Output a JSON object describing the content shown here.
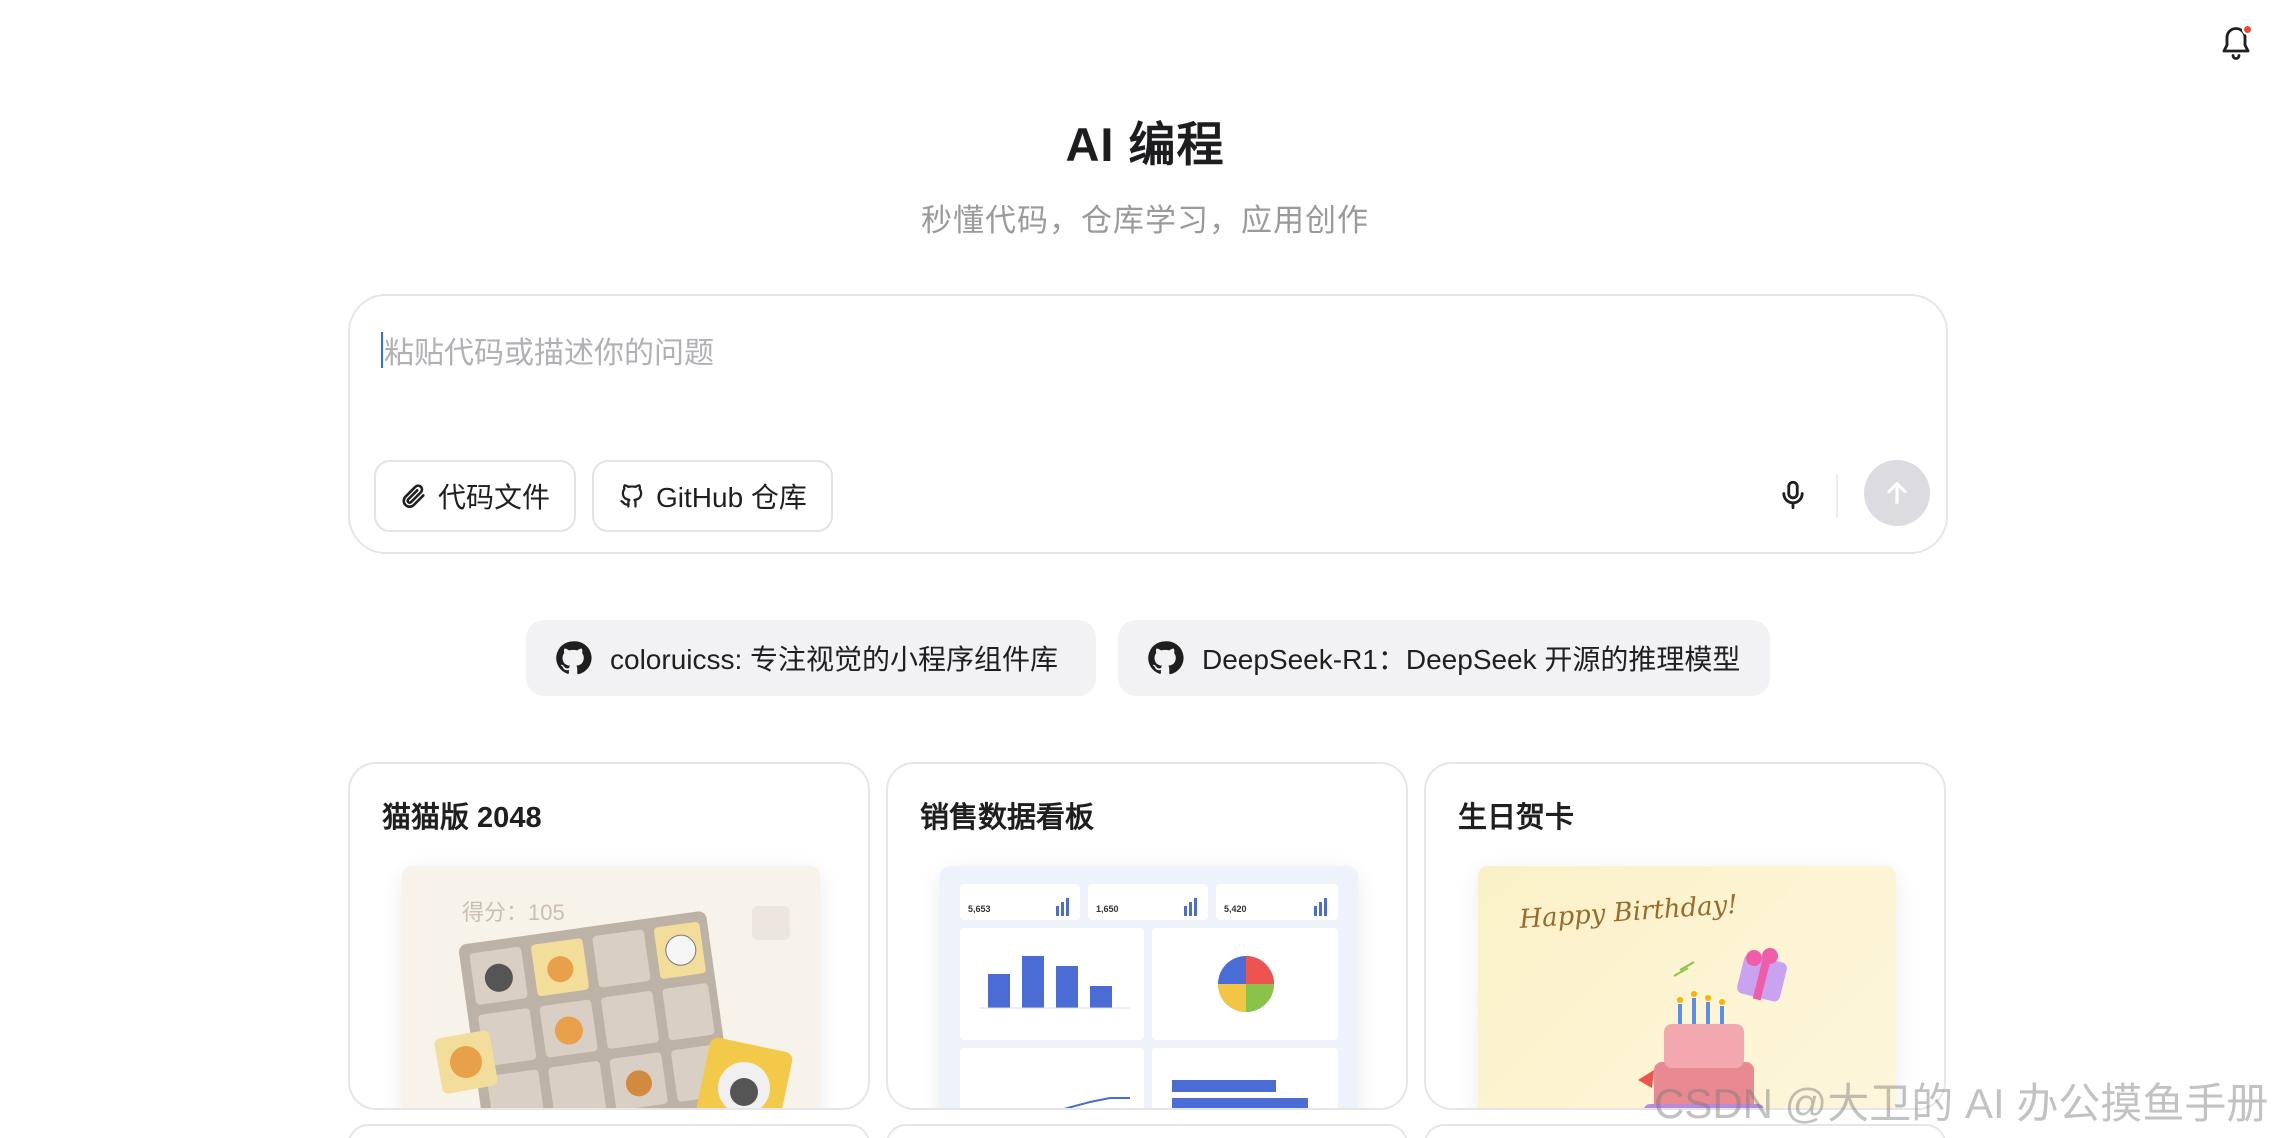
{
  "header": {
    "title": "AI 编程",
    "subtitle": "秒懂代码，仓库学习，应用创作"
  },
  "composer": {
    "placeholder": "粘贴代码或描述你的问题",
    "code_file_label": "代码文件",
    "github_label": "GitHub 仓库"
  },
  "repos": [
    {
      "label": "coloruicss: 专注视觉的小程序组件库"
    },
    {
      "label": "DeepSeek-R1：DeepSeek 开源的推理模型"
    }
  ],
  "cards": [
    {
      "title": "猫猫版 2048",
      "score_label": "得分：105"
    },
    {
      "title": "销售数据看板",
      "stats": [
        "5,653",
        "1,650",
        "5,420"
      ]
    },
    {
      "title": "生日贺卡",
      "greeting": "Happy Birthday!"
    }
  ],
  "watermark": "CSDN @大卫的 AI 办公摸鱼手册",
  "colors": {
    "accent": "#2f6bff",
    "notification": "#f04438",
    "chart_blue": "#4a6cd4"
  }
}
